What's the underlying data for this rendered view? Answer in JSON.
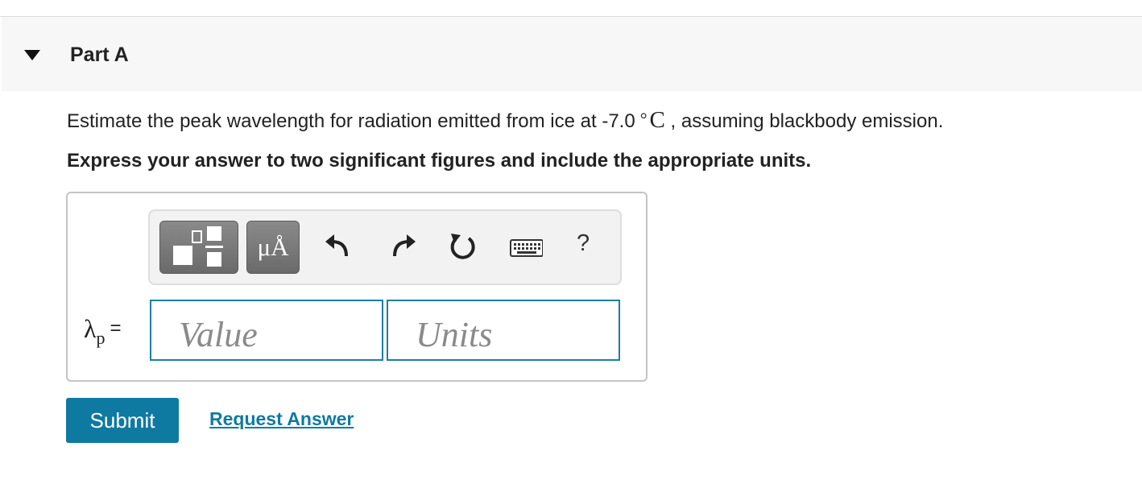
{
  "part": {
    "title": "Part A"
  },
  "question": {
    "text_before": "Estimate the peak wavelength for radiation emitted from ice at -7.0",
    "degree": "°",
    "unit": "C",
    "text_after": ", assuming blackbody emission."
  },
  "instruction": "Express your answer to two significant figures and include the appropriate units.",
  "toolbar": {
    "units_button_label": "μÅ",
    "help_label": "?",
    "icons": [
      "templates-icon",
      "undo-icon",
      "redo-icon",
      "reset-icon",
      "keyboard-icon",
      "help-icon"
    ]
  },
  "answer": {
    "symbol": "λ",
    "subscript": "p",
    "equals": "=",
    "value_placeholder": "Value",
    "units_placeholder": "Units"
  },
  "actions": {
    "submit_label": "Submit",
    "request_label": "Request Answer"
  },
  "colors": {
    "accent": "#0f7aa1",
    "header_bg": "#f7f7f7",
    "toolbar_button": "#767676"
  }
}
